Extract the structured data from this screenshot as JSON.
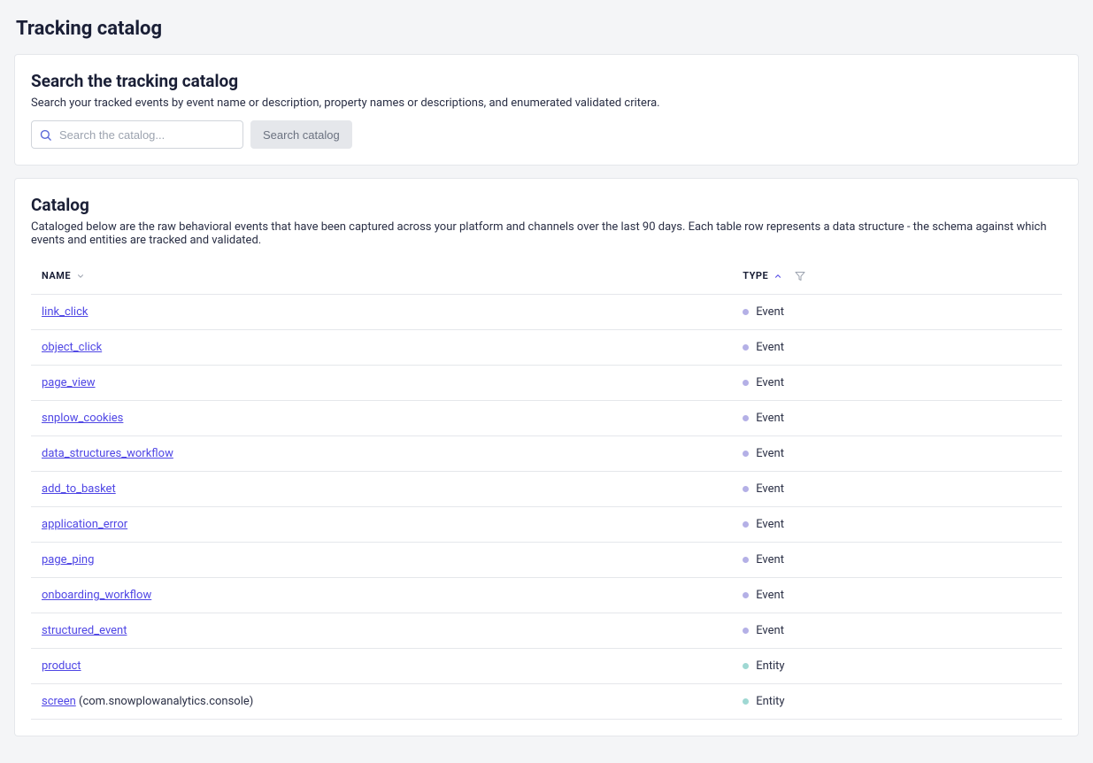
{
  "page": {
    "title": "Tracking catalog"
  },
  "search": {
    "heading": "Search the tracking catalog",
    "description": "Search your tracked events by event name or description, property names or descriptions, and enumerated validated critera.",
    "placeholder": "Search the catalog...",
    "button_label": "Search catalog"
  },
  "catalog": {
    "heading": "Catalog",
    "description": "Cataloged below are the raw behavioral events that have been captured across your platform and channels over the last 90 days. Each table row represents a data structure - the schema against which events and entities are tracked and validated.",
    "columns": {
      "name": "NAME",
      "type": "TYPE"
    },
    "sort": {
      "column": "type",
      "direction": "asc"
    },
    "rows": [
      {
        "name": "link_click",
        "suffix": "",
        "type": "Event"
      },
      {
        "name": "object_click",
        "suffix": "",
        "type": "Event"
      },
      {
        "name": "page_view",
        "suffix": "",
        "type": "Event"
      },
      {
        "name": "snplow_cookies",
        "suffix": "",
        "type": "Event"
      },
      {
        "name": "data_structures_workflow",
        "suffix": "",
        "type": "Event"
      },
      {
        "name": "add_to_basket",
        "suffix": "",
        "type": "Event"
      },
      {
        "name": "application_error",
        "suffix": "",
        "type": "Event"
      },
      {
        "name": "page_ping",
        "suffix": "",
        "type": "Event"
      },
      {
        "name": "onboarding_workflow",
        "suffix": "",
        "type": "Event"
      },
      {
        "name": "structured_event",
        "suffix": "",
        "type": "Event"
      },
      {
        "name": "product",
        "suffix": "",
        "type": "Entity"
      },
      {
        "name": "screen",
        "suffix": " (com.snowplowanalytics.console)",
        "type": "Entity"
      }
    ]
  }
}
